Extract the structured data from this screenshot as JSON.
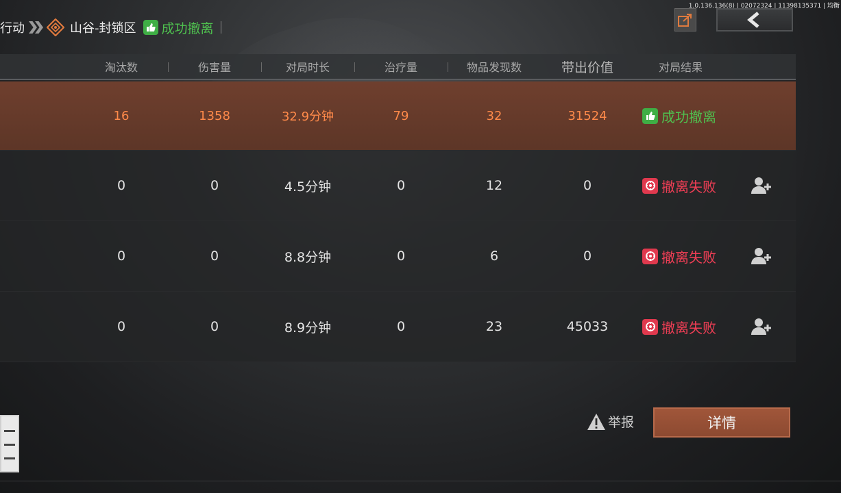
{
  "debug_text": "1.0.136.136(8) | 02072324 | 11398135371 | 均衡",
  "breadcrumb": {
    "mode": "行动",
    "map": "山谷-封锁区",
    "status": "成功撤离"
  },
  "table": {
    "headers": [
      "淘汰数",
      "伤害量",
      "对局时长",
      "治疗量",
      "物品发现数",
      "带出价值",
      "对局结果"
    ],
    "rows": [
      {
        "eliminations": "16",
        "damage": "1358",
        "duration": "32.9分钟",
        "healing": "79",
        "items_found": "32",
        "value": "31524",
        "result": "成功撤离",
        "result_type": "success",
        "self": true
      },
      {
        "eliminations": "0",
        "damage": "0",
        "duration": "4.5分钟",
        "healing": "0",
        "items_found": "12",
        "value": "0",
        "result": "撤离失败",
        "result_type": "fail",
        "self": false
      },
      {
        "eliminations": "0",
        "damage": "0",
        "duration": "8.8分钟",
        "healing": "0",
        "items_found": "6",
        "value": "0",
        "result": "撤离失败",
        "result_type": "fail",
        "self": false
      },
      {
        "eliminations": "0",
        "damage": "0",
        "duration": "8.9分钟",
        "healing": "0",
        "items_found": "23",
        "value": "45033",
        "result": "撤离失败",
        "result_type": "fail",
        "self": false
      }
    ]
  },
  "footer": {
    "report_label": "举报",
    "detail_label": "详情"
  },
  "colors": {
    "success": "#4fc14f",
    "fail": "#ef3e55",
    "self_row_text": "#ff8a4a",
    "accent_button": "#9b5337"
  },
  "icons": {
    "share": "share-icon",
    "back": "back-arrow-icon",
    "add_friend": "add-friend-icon",
    "warning": "warning-icon",
    "map": "map-emblem-icon"
  }
}
